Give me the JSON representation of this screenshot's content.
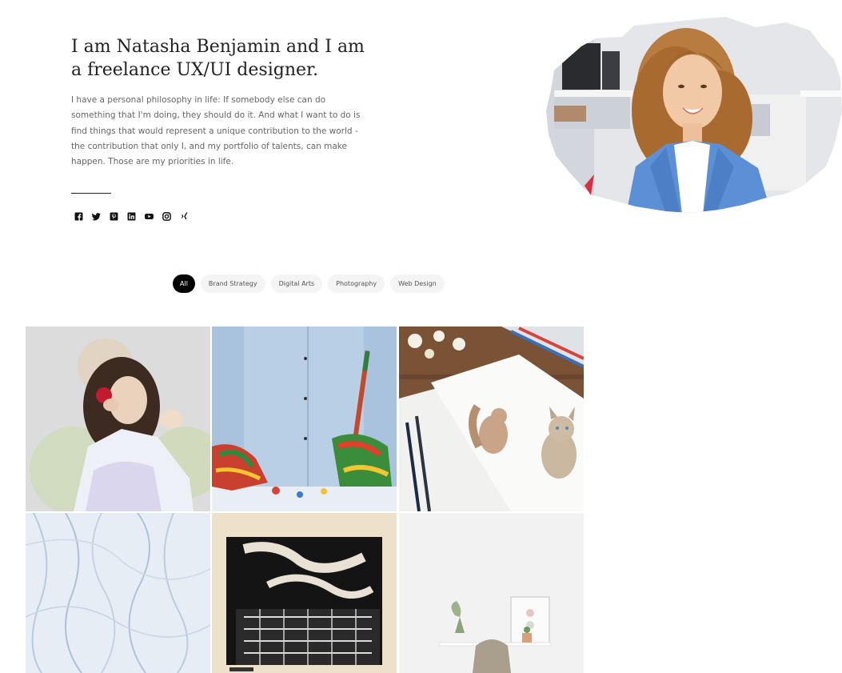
{
  "intro": {
    "title": "I am Natasha Benjamin and I am a freelance UX/UI designer.",
    "text": "I have a personal philosophy in life: If somebody else can do something that I'm doing, they should do it. And what I want to do is find things that would represent a unique contribution to the world - the contribution that only I, and my portfolio of talents, can make happen. Those are my priorities in life."
  },
  "social": [
    {
      "name": "facebook-icon"
    },
    {
      "name": "twitter-icon"
    },
    {
      "name": "pinterest-icon"
    },
    {
      "name": "linkedin-icon"
    },
    {
      "name": "youtube-icon"
    },
    {
      "name": "instagram-icon"
    },
    {
      "name": "xing-icon"
    }
  ],
  "filters": {
    "all": "All",
    "brand_strategy": "Brand Strategy",
    "digital_arts": "Digital Arts",
    "photography": "Photography",
    "web_design": "Web Design",
    "active": "All"
  },
  "portfolio": [
    {
      "subject": "watercolor-woman-with-apple"
    },
    {
      "subject": "painted-hands-with-brush"
    },
    {
      "subject": "animal-sketches-with-pencils"
    },
    {
      "subject": "blue-smoke-texture"
    },
    {
      "subject": "woodcut-print-reclining-figure"
    },
    {
      "subject": "minimal-desk-with-chair"
    }
  ],
  "colors": {
    "accent": "#000000",
    "chip_bg": "#f4f4f4",
    "blazer": "#5b8fd6"
  }
}
